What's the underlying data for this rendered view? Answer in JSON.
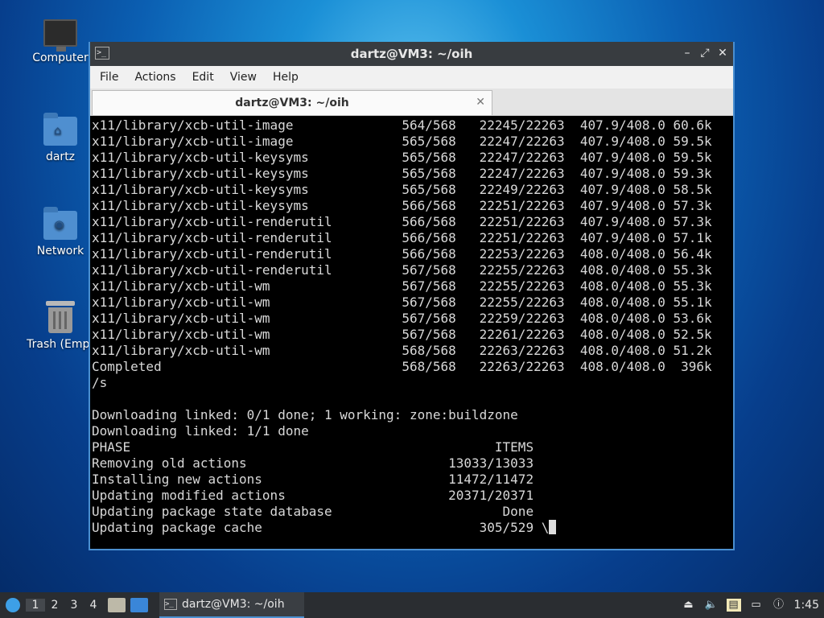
{
  "desktop": {
    "icons": [
      {
        "label": "Computer"
      },
      {
        "label": "dartz"
      },
      {
        "label": "Network"
      },
      {
        "label": "Trash (Empt"
      }
    ]
  },
  "window": {
    "title": "dartz@VM3: ~/oih",
    "controls": {
      "minimize": "–",
      "maximize": "⤢",
      "close": "✕"
    },
    "menu": [
      "File",
      "Actions",
      "Edit",
      "View",
      "Help"
    ],
    "tab": {
      "label": "dartz@VM3: ~/oih",
      "close": "✕"
    },
    "terminal_lines": [
      "x11/library/xcb-util-image              564/568   22245/22263  407.9/408.0 60.6k",
      "x11/library/xcb-util-image              565/568   22247/22263  407.9/408.0 59.5k",
      "x11/library/xcb-util-keysyms            565/568   22247/22263  407.9/408.0 59.5k",
      "x11/library/xcb-util-keysyms            565/568   22247/22263  407.9/408.0 59.3k",
      "x11/library/xcb-util-keysyms            565/568   22249/22263  407.9/408.0 58.5k",
      "x11/library/xcb-util-keysyms            566/568   22251/22263  407.9/408.0 57.3k",
      "x11/library/xcb-util-renderutil         566/568   22251/22263  407.9/408.0 57.3k",
      "x11/library/xcb-util-renderutil         566/568   22251/22263  407.9/408.0 57.1k",
      "x11/library/xcb-util-renderutil         566/568   22253/22263  408.0/408.0 56.4k",
      "x11/library/xcb-util-renderutil         567/568   22255/22263  408.0/408.0 55.3k",
      "x11/library/xcb-util-wm                 567/568   22255/22263  408.0/408.0 55.3k",
      "x11/library/xcb-util-wm                 567/568   22255/22263  408.0/408.0 55.1k",
      "x11/library/xcb-util-wm                 567/568   22259/22263  408.0/408.0 53.6k",
      "x11/library/xcb-util-wm                 567/568   22261/22263  408.0/408.0 52.5k",
      "x11/library/xcb-util-wm                 568/568   22263/22263  408.0/408.0 51.2k",
      "Completed                               568/568   22263/22263  408.0/408.0  396k",
      "/s",
      "",
      "Downloading linked: 0/1 done; 1 working: zone:buildzone",
      "Downloading linked: 1/1 done",
      "PHASE                                               ITEMS",
      "Removing old actions                          13033/13033",
      "Installing new actions                        11472/11472",
      "Updating modified actions                     20371/20371",
      "Updating package state database                      Done",
      "Updating package cache                            305/529 \\"
    ]
  },
  "taskbar": {
    "workspaces": [
      "1",
      "2",
      "3",
      "4"
    ],
    "active_workspace": "1",
    "task_label": "dartz@VM3: ~/oih",
    "clock": "1:45"
  },
  "colors": {
    "window_border": "#4a8fd0",
    "terminal_bg": "#000000",
    "terminal_fg": "#d8d8d8",
    "taskbar_bg": "#2a2d31"
  }
}
